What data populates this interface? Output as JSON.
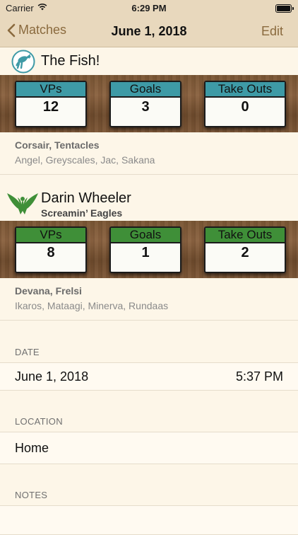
{
  "status_bar": {
    "carrier": "Carrier",
    "time": "6:29 PM"
  },
  "nav": {
    "back_label": "Matches",
    "title": "June 1, 2018",
    "edit_label": "Edit"
  },
  "players": [
    {
      "name": "The Fish!",
      "team": "",
      "icon": "fish-player-icon",
      "accent": "#3e9aa6",
      "stats": [
        {
          "label": "VPs",
          "value": "12"
        },
        {
          "label": "Goals",
          "value": "3"
        },
        {
          "label": "Take Outs",
          "value": "0"
        }
      ],
      "captains": "Corsair, Tentacles",
      "squad": "Angel, Greyscales, Jac, Sakana"
    },
    {
      "name": "Darin Wheeler",
      "team": "Screamin’ Eagles",
      "icon": "eagle-team-icon",
      "accent": "#3f8f38",
      "stats": [
        {
          "label": "VPs",
          "value": "8"
        },
        {
          "label": "Goals",
          "value": "1"
        },
        {
          "label": "Take Outs",
          "value": "2"
        }
      ],
      "captains": "Devana, Frelsi",
      "squad": "Ikaros, Mataagi, Minerva, Rundaas"
    }
  ],
  "date_section": {
    "header": "DATE",
    "date": "June 1, 2018",
    "time": "5:37 PM"
  },
  "location_section": {
    "header": "LOCATION",
    "value": "Home"
  },
  "notes_section": {
    "header": "NOTES",
    "value": ""
  }
}
